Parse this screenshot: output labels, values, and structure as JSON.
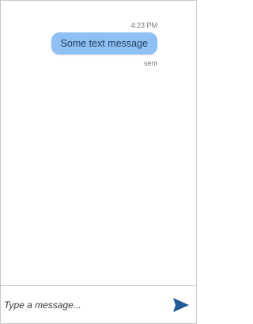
{
  "messages": [
    {
      "time": "4:23 PM",
      "text": "Some text message",
      "status": "sent"
    }
  ],
  "composer": {
    "placeholder": "Type a message...",
    "send_icon": "send-icon"
  },
  "colors": {
    "bubble": "#8ec0f5",
    "bubble_text": "#23405e",
    "send_icon": "#1f5a96",
    "border": "#c8c8c8"
  }
}
